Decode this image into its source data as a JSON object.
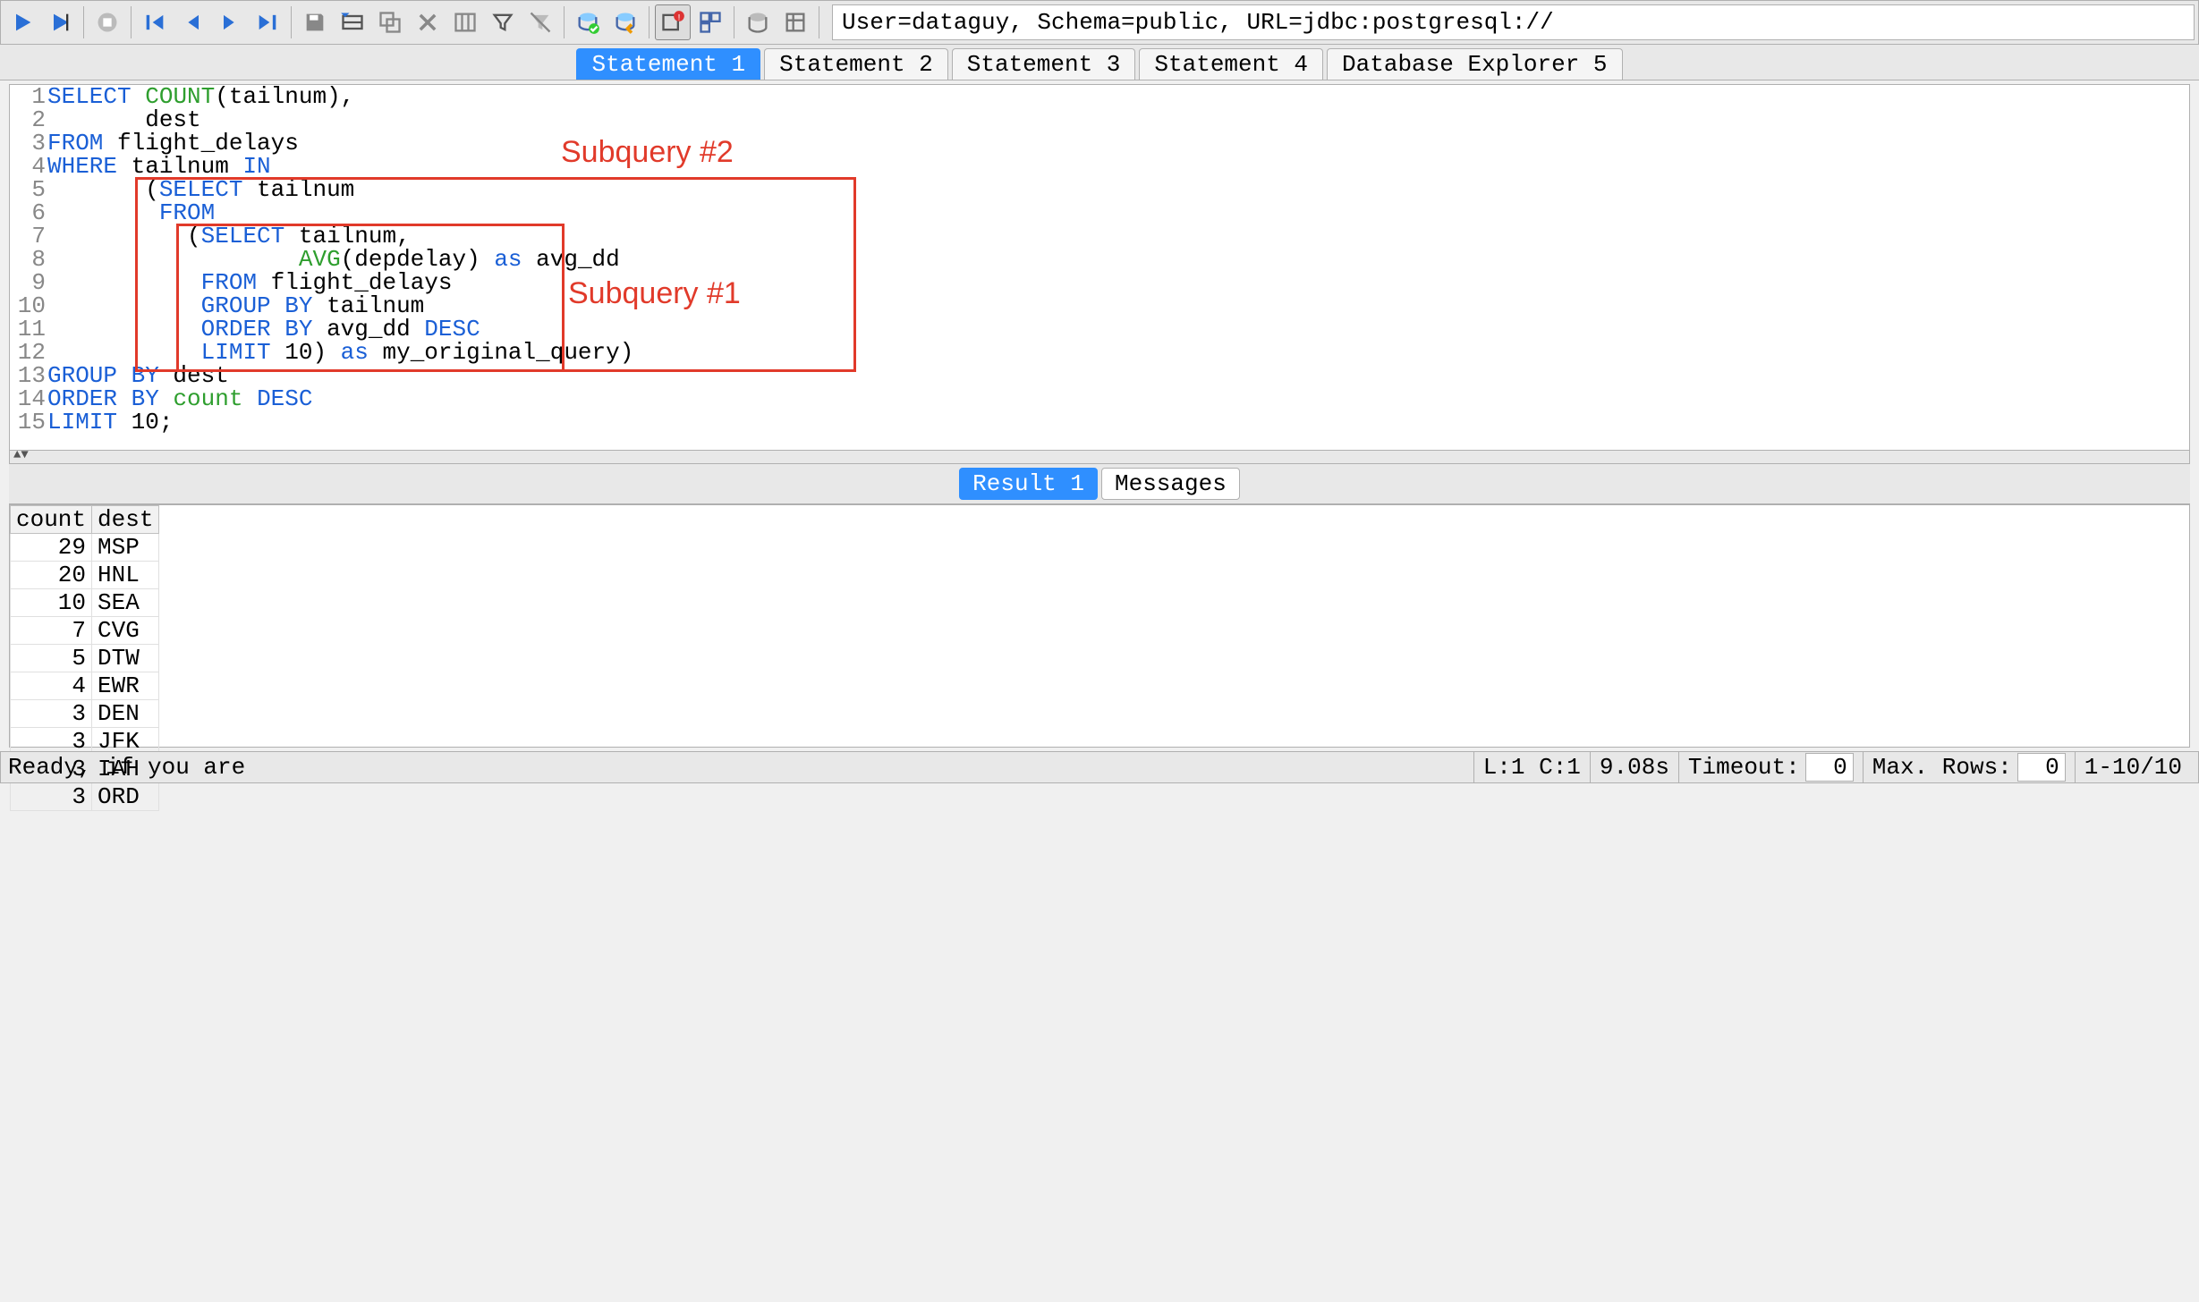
{
  "toolbar": {
    "conn_info": "User=dataguy, Schema=public, URL=jdbc:postgresql://"
  },
  "tabs": [
    "Statement 1",
    "Statement 2",
    "Statement 3",
    "Statement 4",
    "Database Explorer 5"
  ],
  "active_tab": 0,
  "sql_lines": [
    [
      {
        "t": "SELECT",
        "c": "kw"
      },
      {
        "t": " "
      },
      {
        "t": "COUNT",
        "c": "fn"
      },
      {
        "t": "(tailnum),"
      }
    ],
    [
      {
        "t": "       dest"
      }
    ],
    [
      {
        "t": "FROM",
        "c": "kw"
      },
      {
        "t": " flight_delays"
      }
    ],
    [
      {
        "t": "WHERE",
        "c": "kw"
      },
      {
        "t": " tailnum "
      },
      {
        "t": "IN",
        "c": "kw"
      }
    ],
    [
      {
        "t": "       ("
      },
      {
        "t": "SELECT",
        "c": "kw"
      },
      {
        "t": " tailnum"
      }
    ],
    [
      {
        "t": "        "
      },
      {
        "t": "FROM",
        "c": "kw"
      }
    ],
    [
      {
        "t": "          ("
      },
      {
        "t": "SELECT",
        "c": "kw"
      },
      {
        "t": " tailnum,"
      }
    ],
    [
      {
        "t": "                  "
      },
      {
        "t": "AVG",
        "c": "fn"
      },
      {
        "t": "(depdelay) "
      },
      {
        "t": "as",
        "c": "kw"
      },
      {
        "t": " avg_dd"
      }
    ],
    [
      {
        "t": "           "
      },
      {
        "t": "FROM",
        "c": "kw"
      },
      {
        "t": " flight_delays"
      }
    ],
    [
      {
        "t": "           "
      },
      {
        "t": "GROUP BY",
        "c": "kw"
      },
      {
        "t": " tailnum"
      }
    ],
    [
      {
        "t": "           "
      },
      {
        "t": "ORDER BY",
        "c": "kw"
      },
      {
        "t": " avg_dd "
      },
      {
        "t": "DESC",
        "c": "kw"
      }
    ],
    [
      {
        "t": "           "
      },
      {
        "t": "LIMIT",
        "c": "kw"
      },
      {
        "t": " 10) "
      },
      {
        "t": "as",
        "c": "kw"
      },
      {
        "t": " my_original_query)"
      }
    ],
    [
      {
        "t": "GROUP BY",
        "c": "kw"
      },
      {
        "t": " dest"
      }
    ],
    [
      {
        "t": "ORDER BY",
        "c": "kw"
      },
      {
        "t": " "
      },
      {
        "t": "count",
        "c": "fn"
      },
      {
        "t": " "
      },
      {
        "t": "DESC",
        "c": "kw"
      }
    ],
    [
      {
        "t": "LIMIT",
        "c": "kw"
      },
      {
        "t": " 10;"
      }
    ]
  ],
  "annotations": {
    "sub2": "Subquery #2",
    "sub1": "Subquery #1"
  },
  "result_tabs": [
    "Result 1",
    "Messages"
  ],
  "active_result_tab": 0,
  "result": {
    "columns": [
      "count",
      "dest"
    ],
    "rows": [
      [
        29,
        "MSP"
      ],
      [
        20,
        "HNL"
      ],
      [
        10,
        "SEA"
      ],
      [
        7,
        "CVG"
      ],
      [
        5,
        "DTW"
      ],
      [
        4,
        "EWR"
      ],
      [
        3,
        "DEN"
      ],
      [
        3,
        "JFK"
      ],
      [
        3,
        "IAH"
      ],
      [
        3,
        "ORD"
      ]
    ]
  },
  "status": {
    "ready": "Ready, if you are",
    "pos": "L:1 C:1",
    "time": "9.08s",
    "timeout_label": "Timeout:",
    "timeout_val": "0",
    "maxrows_label": "Max. Rows:",
    "maxrows_val": "0",
    "range": "1-10/10"
  }
}
